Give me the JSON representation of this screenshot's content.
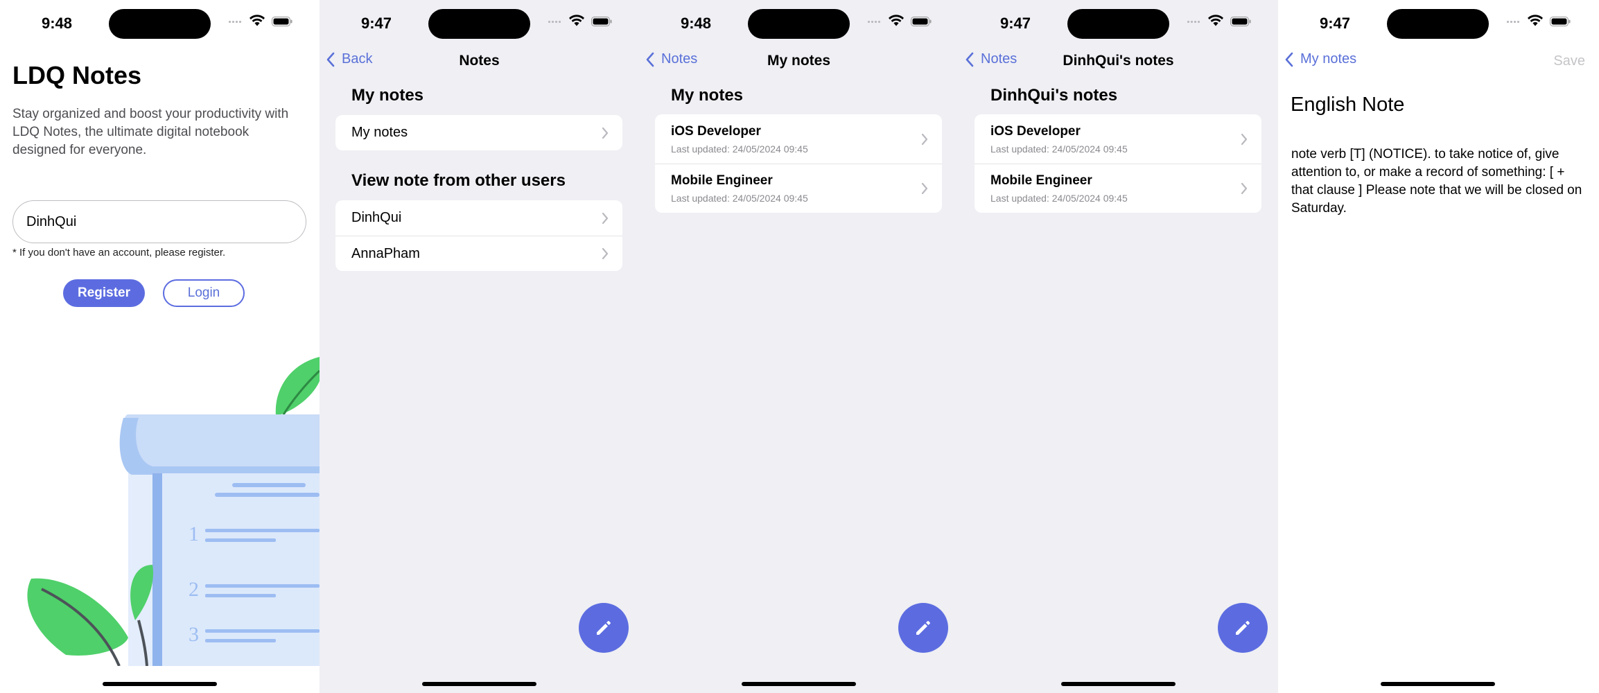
{
  "colors": {
    "accent": "#5c6ce0",
    "link": "#5a70d8",
    "background": "#efeff4"
  },
  "icons": {
    "back": "chevron-left-icon",
    "disclosure": "chevron-right-icon",
    "compose": "pencil-icon",
    "wifi": "wifi-icon",
    "battery": "battery-icon"
  },
  "screens": [
    {
      "status": {
        "time": "9:48"
      },
      "login": {
        "title": "LDQ Notes",
        "description": "Stay organized and boost your productivity with LDQ Notes, the ultimate digital notebook designed for everyone.",
        "username_value": "DinhQui",
        "hint": "* If you don't have an account, please register.",
        "register_label": "Register",
        "login_label": "Login"
      }
    },
    {
      "status": {
        "time": "9:47"
      },
      "nav": {
        "back": "Back",
        "title": "Notes"
      },
      "sections": [
        {
          "title": "My notes",
          "rows": [
            "My notes"
          ]
        },
        {
          "title": "View note from other users",
          "rows": [
            "DinhQui",
            "AnnaPham"
          ]
        }
      ]
    },
    {
      "status": {
        "time": "9:48"
      },
      "nav": {
        "back": "Notes",
        "title": "My notes"
      },
      "section_title": "My notes",
      "notes": [
        {
          "title": "iOS Developer",
          "updated": "Last updated: 24/05/2024 09:45"
        },
        {
          "title": "Mobile Engineer",
          "updated": "Last updated: 24/05/2024 09:45"
        }
      ]
    },
    {
      "status": {
        "time": "9:47"
      },
      "nav": {
        "back": "Notes",
        "title": "DinhQui's notes"
      },
      "section_title": "DinhQui's notes",
      "notes": [
        {
          "title": "iOS Developer",
          "updated": "Last updated: 24/05/2024 09:45"
        },
        {
          "title": "Mobile Engineer",
          "updated": "Last updated: 24/05/2024 09:45"
        }
      ]
    },
    {
      "status": {
        "time": "9:47"
      },
      "nav": {
        "back": "My notes",
        "save": "Save"
      },
      "note": {
        "title": "English Note",
        "body": "note verb [T] (NOTICE). to take notice of, give attention to, or make a record of something: [ + that clause ] Please note that we will be closed on Saturday."
      }
    }
  ]
}
